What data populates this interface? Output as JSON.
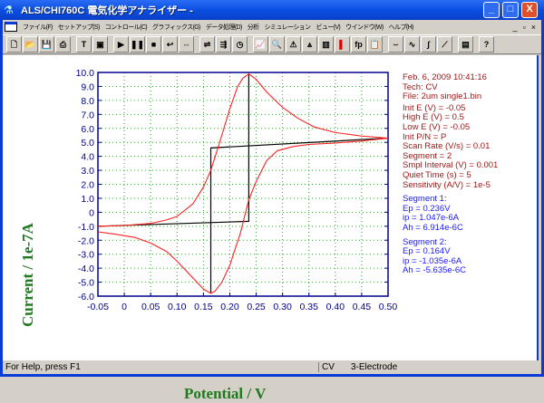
{
  "window": {
    "title": "ALS/CHI760C 電気化学アナライザー -",
    "min": "_",
    "max": "□",
    "close": "X"
  },
  "menu": [
    "ファイル(F)",
    "セットアップ(S)",
    "コントロール(C)",
    "グラフィックス(G)",
    "データ処理(D)",
    "分析",
    "シミュレーション",
    "ビュー(V)",
    "ウインドウ(W)",
    "ヘルプ(H)"
  ],
  "menu_right": [
    "_",
    "▫",
    "×"
  ],
  "toolbar": [
    [
      "new-icon",
      "🗋"
    ],
    [
      "open-icon",
      "📂"
    ],
    [
      "save-icon",
      "💾"
    ],
    [
      "print-icon",
      "⎙"
    ],
    "gap",
    [
      "text-icon",
      "T"
    ],
    [
      "image-icon",
      "▣"
    ],
    "gap",
    [
      "run-icon",
      "▶"
    ],
    [
      "pause-icon",
      "❚❚"
    ],
    [
      "stop-icon",
      "■"
    ],
    [
      "reverse-icon",
      "↩"
    ],
    [
      "disabled-icon",
      "⇔"
    ],
    "gap",
    [
      "technique-icon",
      "⇌"
    ],
    [
      "parameters-icon",
      "⇶"
    ],
    [
      "timer-icon",
      "◷"
    ],
    "gap",
    [
      "graph-icon",
      "📈"
    ],
    [
      "zoom-icon",
      "🔍"
    ],
    [
      "peak-icon",
      "⚠"
    ],
    [
      "overlay-icon",
      "⩓"
    ],
    [
      "graph-options-icon",
      "▥"
    ],
    [
      "color-icon",
      "▌"
    ],
    [
      "format-icon",
      "fp"
    ],
    [
      "copy-icon",
      "📋"
    ],
    "gap",
    [
      "smooth-icon",
      "⌣"
    ],
    [
      "derivative-icon",
      "∿"
    ],
    [
      "integrate-icon",
      "∫"
    ],
    [
      "baseline-icon",
      "⟋"
    ],
    "gap",
    [
      "notes-icon",
      "▤"
    ],
    "gap",
    [
      "help-icon",
      "?"
    ]
  ],
  "status": {
    "help": "For Help, press F1",
    "tech": "CV",
    "electrode": "3-Electrode"
  },
  "info": {
    "header": [
      "Feb. 6, 2009   10:41:16",
      "Tech: CV",
      "File: 2um single1.bin"
    ],
    "params": [
      "Init E (V) = -0.05",
      "High E (V) = 0.5",
      "Low E (V) = -0.05",
      "Init P/N = P",
      "Scan Rate (V/s) = 0.01",
      "Segment = 2",
      "Smpl Interval (V) = 0.001",
      "Quiet Time (s) = 5",
      "Sensitivity (A/V) = 1e-5"
    ],
    "seg1": [
      "Segment 1:",
      "Ep = 0.236V",
      "ip = 1.047e-6A",
      "Ah = 6.914e-6C"
    ],
    "seg2": [
      "Segment 2:",
      "Ep = 0.164V",
      "ip = -1.035e-6A",
      "Ah = -5.635e-6C"
    ]
  },
  "chart_data": {
    "type": "line",
    "xlabel": "Potential / V",
    "ylabel": "Current / 1e-7A",
    "xlim": [
      -0.05,
      0.5
    ],
    "ylim": [
      -6,
      10
    ],
    "xticks": [
      "-0.05",
      "0",
      "0.05",
      "0.10",
      "0.15",
      "0.20",
      "0.25",
      "0.30",
      "0.35",
      "0.40",
      "0.45",
      "0.50"
    ],
    "yticks": [
      "10.0",
      "9.0",
      "8.0",
      "7.0",
      "6.0",
      "5.0",
      "4.0",
      "3.0",
      "2.0",
      "1.0",
      "0",
      "-1.0",
      "-2.0",
      "-3.0",
      "-4.0",
      "-5.0",
      "-6.0"
    ],
    "grid": true,
    "series": [
      {
        "name": "segment-1",
        "color": "#ff2020",
        "points": [
          [
            -0.05,
            -1.0
          ],
          [
            0,
            -0.95
          ],
          [
            0.05,
            -0.8
          ],
          [
            0.08,
            -0.55
          ],
          [
            0.1,
            -0.3
          ],
          [
            0.13,
            0.6
          ],
          [
            0.15,
            1.8
          ],
          [
            0.164,
            3.0
          ],
          [
            0.18,
            4.9
          ],
          [
            0.2,
            7.4
          ],
          [
            0.215,
            9.0
          ],
          [
            0.225,
            9.6
          ],
          [
            0.236,
            9.9
          ],
          [
            0.25,
            9.5
          ],
          [
            0.27,
            8.6
          ],
          [
            0.3,
            7.5
          ],
          [
            0.33,
            6.7
          ],
          [
            0.36,
            6.1
          ],
          [
            0.4,
            5.7
          ],
          [
            0.45,
            5.45
          ],
          [
            0.5,
            5.3
          ]
        ]
      },
      {
        "name": "segment-2",
        "color": "#ff2020",
        "points": [
          [
            0.5,
            5.3
          ],
          [
            0.45,
            5.1
          ],
          [
            0.4,
            4.95
          ],
          [
            0.35,
            4.85
          ],
          [
            0.32,
            4.7
          ],
          [
            0.29,
            4.4
          ],
          [
            0.27,
            3.7
          ],
          [
            0.25,
            2.2
          ],
          [
            0.236,
            0.9
          ],
          [
            0.22,
            -1.5
          ],
          [
            0.2,
            -3.8
          ],
          [
            0.185,
            -5.0
          ],
          [
            0.172,
            -5.65
          ],
          [
            0.164,
            -5.8
          ],
          [
            0.15,
            -5.5
          ],
          [
            0.13,
            -4.7
          ],
          [
            0.1,
            -3.5
          ],
          [
            0.08,
            -2.8
          ],
          [
            0.05,
            -2.2
          ],
          [
            0.02,
            -1.8
          ],
          [
            -0.02,
            -1.55
          ],
          [
            -0.05,
            -1.4
          ]
        ]
      }
    ],
    "baselines": [
      {
        "name": "baseline-1",
        "points": [
          [
            -0.05,
            -1.0
          ],
          [
            0.236,
            -0.65
          ],
          [
            0.236,
            9.9
          ]
        ]
      },
      {
        "name": "baseline-2",
        "points": [
          [
            0.5,
            5.3
          ],
          [
            0.164,
            4.6
          ],
          [
            0.164,
            -5.8
          ]
        ]
      }
    ]
  }
}
